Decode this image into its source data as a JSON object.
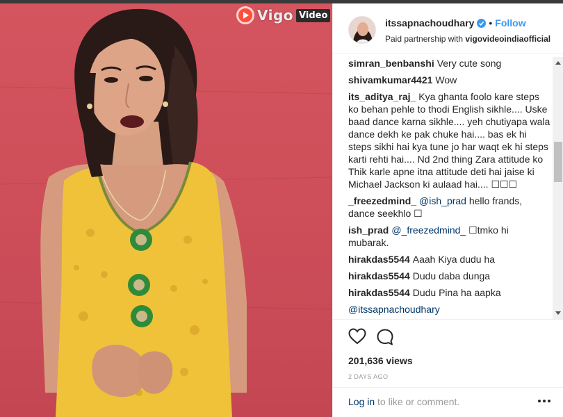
{
  "video": {
    "watermark_word": "Vigo",
    "watermark_tag": "Video",
    "icon": "vigo-play-icon"
  },
  "post": {
    "username": "itssapnachoudhary",
    "verified_icon": "verified-badge-icon",
    "separator": "•",
    "follow_label": "Follow",
    "partnership_prefix": "Paid partnership with",
    "partner": "vigovideoindiaofficial"
  },
  "comments": [
    {
      "user": "simran_benbanshi",
      "text": "Very cute song"
    },
    {
      "user": "shivamkumar4421",
      "text": "Wow"
    },
    {
      "user": "its_aditya_raj_",
      "text": "Kya ghanta foolo kare steps ko behan pehle to thodi English sikhle.... Uske baad dance karna sikhle.... yeh chutiyapa wala dance dekh ke pak chuke hai.... bas ek hi steps sikhi hai kya tune jo har waqt ek hi steps karti rehti hai.... Nd 2nd thing Zara attitude ko Thik karle apne itna attitude deti hai jaise ki Michael Jackson ki aulaad hai.... ☐☐☐"
    },
    {
      "user": "_freezedmind_",
      "mention": "@ish_prad",
      "text": "hello frands, dance seekhlo ☐"
    },
    {
      "user": "ish_prad",
      "mention": "@_freezedmind_",
      "text": "☐tmko hi mubarak."
    },
    {
      "user": "hirakdas5544",
      "text": "Aaah Kiya dudu ha"
    },
    {
      "user": "hirakdas5544",
      "text": "Dudu daba dunga"
    },
    {
      "user": "hirakdas5544",
      "text": "Dudu Pina ha aapka"
    },
    {
      "user": "",
      "mention": "@itssapnachoudhary",
      "text": ""
    }
  ],
  "actions": {
    "like_icon": "heart-outline-icon",
    "comment_icon": "comment-bubble-icon",
    "views": "201,636 views",
    "date": "2 DAYS AGO"
  },
  "footer": {
    "login_link": "Log in",
    "login_rest": "to like or comment.",
    "more_icon": "more-options-icon"
  },
  "colors": {
    "link": "#3897f0",
    "mention": "#003569",
    "muted": "#999999",
    "wall": "#d15260",
    "dress": "#f0c23a"
  }
}
